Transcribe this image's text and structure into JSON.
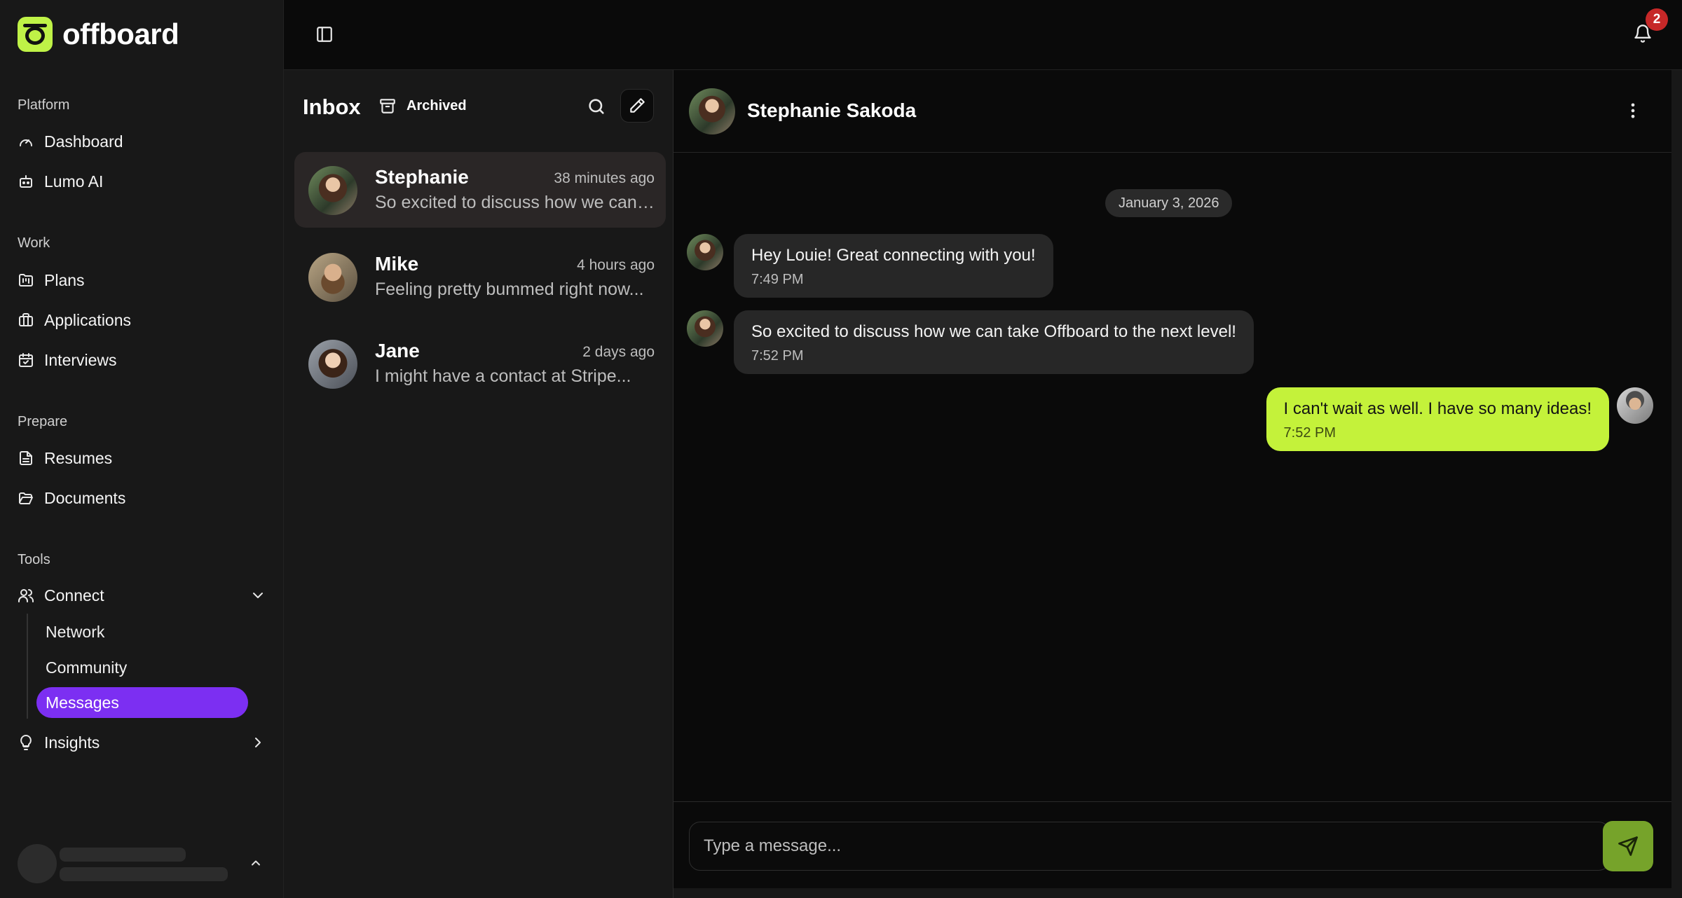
{
  "brand": {
    "name": "offboard",
    "accent": "#bff247"
  },
  "sidebar": {
    "sections": [
      {
        "label": "Platform",
        "items": [
          {
            "label": "Dashboard",
            "icon": "gauge-icon"
          },
          {
            "label": "Lumo AI",
            "icon": "bot-icon"
          }
        ]
      },
      {
        "label": "Work",
        "items": [
          {
            "label": "Plans",
            "icon": "folder-kanban-icon"
          },
          {
            "label": "Applications",
            "icon": "briefcase-icon"
          },
          {
            "label": "Interviews",
            "icon": "calendar-check-icon"
          }
        ]
      },
      {
        "label": "Prepare",
        "items": [
          {
            "label": "Resumes",
            "icon": "file-text-icon"
          },
          {
            "label": "Documents",
            "icon": "folder-open-icon"
          }
        ]
      },
      {
        "label": "Tools",
        "items": [
          {
            "label": "Connect",
            "icon": "users-icon",
            "expanded": true,
            "children": [
              "Network",
              "Community",
              "Messages"
            ],
            "active_child": "Messages"
          },
          {
            "label": "Insights",
            "icon": "lightbulb-icon",
            "expanded": false
          }
        ]
      }
    ],
    "active_color": "#7c2ff2"
  },
  "topbar": {
    "notification_count": "2"
  },
  "inbox": {
    "title": "Inbox",
    "archived_label": "Archived",
    "conversations": [
      {
        "name": "Stephanie",
        "time": "38 minutes ago",
        "preview": "So excited to discuss how we can take Offboard to the next level!",
        "active": true
      },
      {
        "name": "Mike",
        "time": "4 hours ago",
        "preview": "Feeling pretty bummed right now...",
        "active": false
      },
      {
        "name": "Jane",
        "time": "2 days ago",
        "preview": "I might have a contact at Stripe...",
        "active": false
      }
    ]
  },
  "chat": {
    "contact_name": "Stephanie Sakoda",
    "date_label": "January 3, 2026",
    "messages": [
      {
        "direction": "in",
        "text": "Hey Louie! Great connecting with you!",
        "time": "7:49 PM"
      },
      {
        "direction": "in",
        "text": "So excited to discuss how we can take Offboard to the next level!",
        "time": "7:52 PM"
      },
      {
        "direction": "out",
        "text": "I can't wait as well. I have so many ideas!",
        "time": "7:52 PM"
      }
    ],
    "input_placeholder": "Type a message...",
    "outgoing_bubble_color": "#c4f23a",
    "send_button_color": "#76a32a"
  }
}
